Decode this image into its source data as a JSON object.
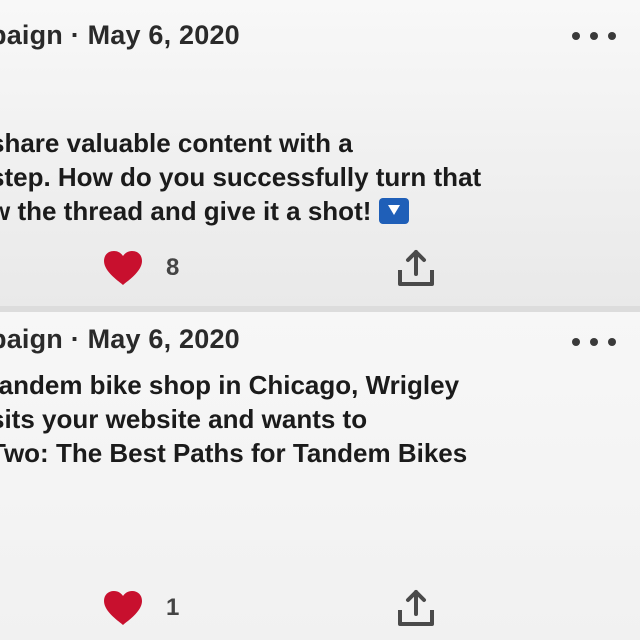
{
  "posts": [
    {
      "meta": "paign · May 6, 2020",
      "lines": [
        "share valuable content with a",
        "step. How do you successfully turn that",
        "w the thread and give it a shot!"
      ],
      "likes": "8"
    },
    {
      "meta": "paign · May 6, 2020",
      "lines": [
        "tandem bike shop in Chicago, Wrigley",
        "sits your website and wants to",
        "Two: The Best Paths for Tandem Bikes"
      ],
      "likes": "1"
    }
  ],
  "icons": {
    "more": "more-options-icon",
    "like": "heart-icon",
    "share": "share-icon",
    "emoji": "down-arrow-emoji-icon"
  },
  "colors": {
    "heart": "#c8102e",
    "emoji": "#1f5fb8"
  }
}
